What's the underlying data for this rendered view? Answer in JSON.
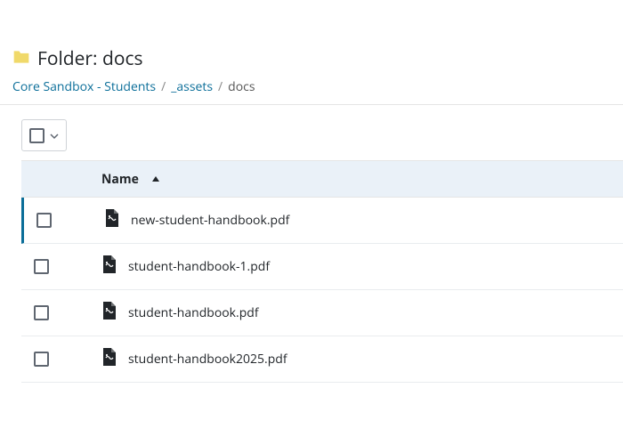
{
  "header": {
    "title_prefix": "Folder: ",
    "folder_name": "docs"
  },
  "breadcrumb": {
    "items": [
      {
        "label": "Core Sandbox - Students",
        "link": true
      },
      {
        "label": "_assets",
        "link": true
      },
      {
        "label": "docs",
        "link": false
      }
    ]
  },
  "table": {
    "columns": {
      "name": "Name"
    },
    "rows": [
      {
        "filename": "new-student-handbook.pdf",
        "highlighted": true
      },
      {
        "filename": "student-handbook-1.pdf",
        "highlighted": false
      },
      {
        "filename": "student-handbook.pdf",
        "highlighted": false
      },
      {
        "filename": "student-handbook2025.pdf",
        "highlighted": false
      }
    ]
  }
}
